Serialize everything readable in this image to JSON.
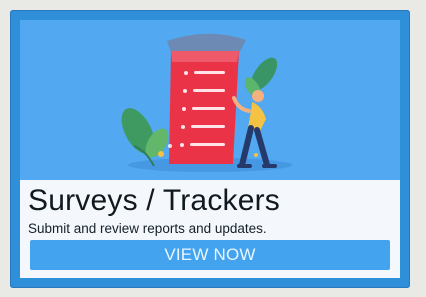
{
  "card": {
    "title": "Surveys / Trackers",
    "description": "Submit and review reports and updates.",
    "button_label": "VIEW NOW"
  },
  "illustration": {
    "subject": "person-reviewing-survey-checklist-icon"
  },
  "colors": {
    "card_border": "#2f8fd9",
    "illustration_background": "#52a8f1",
    "checklist_red": "#eb3348",
    "button_blue": "#44a3ef",
    "content_background": "#f4f7fb"
  }
}
